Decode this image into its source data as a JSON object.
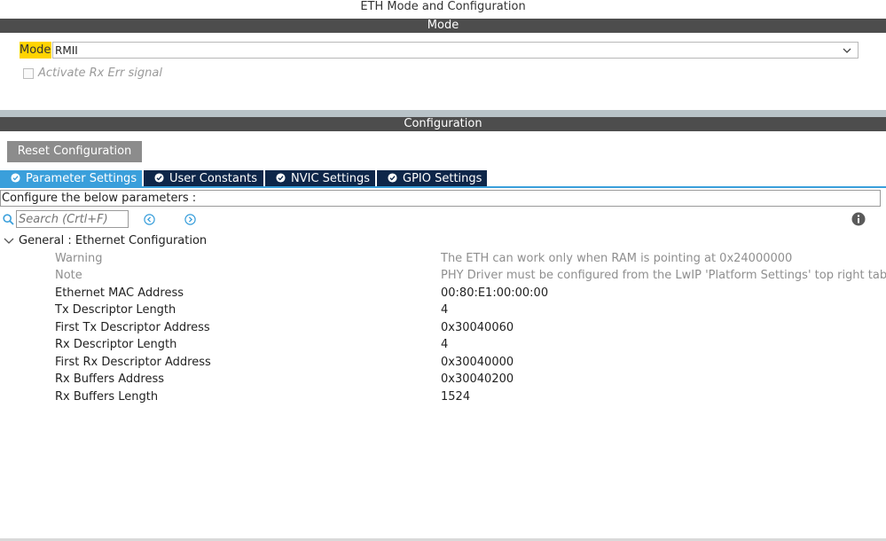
{
  "window": {
    "title": "ETH Mode and Configuration"
  },
  "mode_section": {
    "header": "Mode",
    "mode_label": "Mode",
    "mode_value": "RMII",
    "checkbox_label": "Activate Rx Err signal",
    "checkbox_checked": false
  },
  "config_section": {
    "header": "Configuration",
    "reset_button": "Reset Configuration",
    "tabs": [
      {
        "label": "Parameter Settings",
        "active": true
      },
      {
        "label": "User Constants",
        "active": false
      },
      {
        "label": "NVIC Settings",
        "active": false
      },
      {
        "label": "GPIO Settings",
        "active": false
      }
    ],
    "configure_text": "Configure the below parameters :",
    "search_placeholder": "Search (Crtl+F)",
    "group": {
      "label": "General : Ethernet Configuration",
      "rows": [
        {
          "name": "Warning",
          "value": "The ETH can work only when RAM is pointing at 0x24000000",
          "muted": true
        },
        {
          "name": "Note",
          "value": "PHY Driver must be configured from the LwIP 'Platform Settings' top right tab",
          "muted": true
        },
        {
          "name": "Ethernet MAC Address",
          "value": "00:80:E1:00:00:00",
          "muted": false
        },
        {
          "name": "Tx Descriptor Length",
          "value": "4",
          "muted": false
        },
        {
          "name": "First Tx Descriptor Address",
          "value": "0x30040060",
          "muted": false
        },
        {
          "name": "Rx Descriptor Length",
          "value": "4",
          "muted": false
        },
        {
          "name": "First Rx Descriptor Address",
          "value": "0x30040000",
          "muted": false
        },
        {
          "name": "Rx Buffers Address",
          "value": "0x30040200",
          "muted": false
        },
        {
          "name": "Rx Buffers Length",
          "value": "1524",
          "muted": false
        }
      ]
    }
  },
  "colors": {
    "section_bar": "#4d4d4d",
    "mode_highlight": "#ffd400",
    "tab_active": "#3a9fdb",
    "tab_inactive": "#0e2649",
    "reset_button": "#8c8c8c",
    "icon_blue": "#3a9fdb"
  }
}
